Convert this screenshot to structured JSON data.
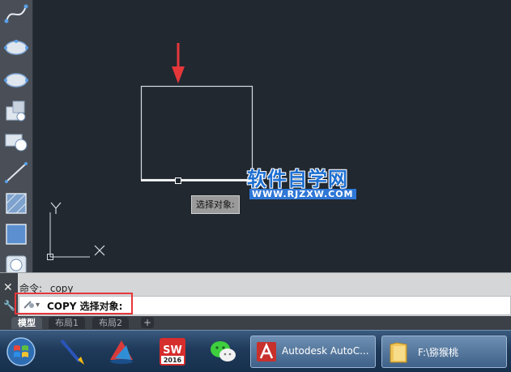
{
  "canvas": {
    "tooltip_text": "选择对象:",
    "ucs_y_label": "Y",
    "ucs_x_label": "X"
  },
  "watermark": {
    "title": "软件自学网",
    "url": "WWW.RJZXW.COM"
  },
  "command": {
    "history_text": "命令: _copy",
    "prompt_text": "COPY 选择对象:",
    "close_glyph": "✕",
    "wrench_glyph": "🔧",
    "dropdown_glyph": "▾"
  },
  "tabs": [
    {
      "label": "模型",
      "active": true
    },
    {
      "label": "布局1",
      "active": false
    },
    {
      "label": "布局2",
      "active": false
    }
  ],
  "tab_add_glyph": "+",
  "taskbar": {
    "start_icon": "windows-start-icon",
    "pinned": [
      {
        "name": "brush-app-icon"
      },
      {
        "name": "autodesk-app-icon"
      },
      {
        "name": "solidworks-2016-icon",
        "label": "2016"
      },
      {
        "name": "wechat-icon"
      }
    ],
    "sw_label": "SW",
    "windows": [
      {
        "name": "autocad-window-button",
        "label": "Autodesk AutoC..."
      },
      {
        "name": "explorer-window-button",
        "label": "F:\\猕猴桃"
      }
    ]
  },
  "colors": {
    "canvas_bg": "#212830",
    "highlight_red": "#e5373a",
    "watermark_blue": "#1e6fd1"
  }
}
